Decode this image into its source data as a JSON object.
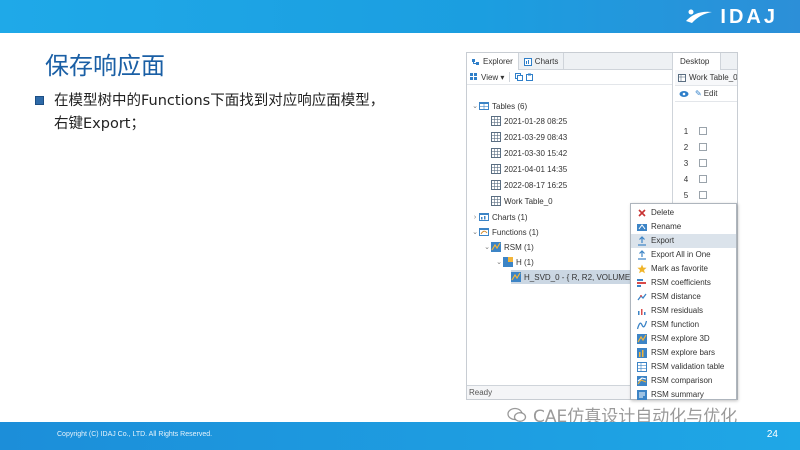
{
  "header": {
    "logo_text": "IDAJ"
  },
  "slide": {
    "title": "保存响应面",
    "bullet_line1": "在模型树中的Functions下面找到对应响应面模型，",
    "bullet_line2": "右键Export；"
  },
  "footer": {
    "copyright": "Copyright (C) IDAJ Co., LTD. All Rights Reserved.",
    "page": "24",
    "watermark": "CAE仿真设计自动化与优化"
  },
  "app": {
    "tabs": [
      "Explorer",
      "Charts"
    ],
    "toolbar": {
      "view_label": "View ▾"
    },
    "tree": {
      "tables": "Tables (6)",
      "table_items": [
        "2021-01-28 08:25",
        "2021-03-29 08:43",
        "2021-03-30 15:42",
        "2021-04-01 14:35",
        "2022-08-17 16:25",
        "Work Table_0"
      ],
      "charts": "Charts (1)",
      "functions": "Functions (1)",
      "rsm": "RSM (1)",
      "h": "H (1)",
      "model": "H_SVD_0 - { R, R2, VOLUME }"
    },
    "status": "Ready",
    "right": {
      "tab": "Desktop",
      "subtab": "Work Table_0",
      "edit": "Edit",
      "rows": [
        "1",
        "2",
        "3",
        "4",
        "5"
      ]
    }
  },
  "context_menu": {
    "items": [
      "Delete",
      "Rename",
      "Export",
      "Export All in One",
      "Mark as favorite",
      "RSM coefficients",
      "RSM distance",
      "RSM residuals",
      "RSM function",
      "RSM explore 3D",
      "RSM explore bars",
      "RSM validation table",
      "RSM comparison",
      "RSM summary"
    ],
    "highlighted": "Export"
  },
  "colors": {
    "header": "#1fa9e8",
    "title": "#1a5fa5",
    "selection": "#cbd7e3"
  }
}
